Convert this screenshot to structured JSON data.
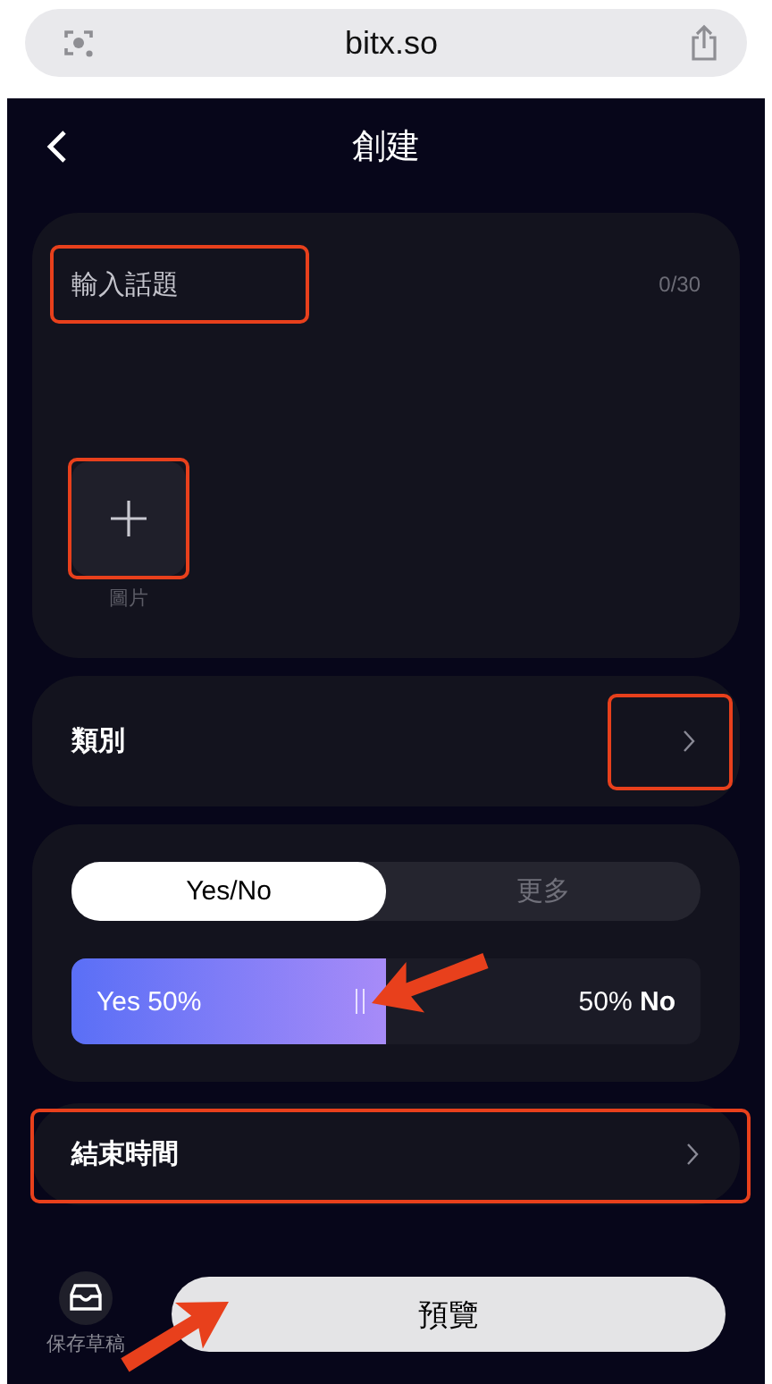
{
  "browser": {
    "url": "bitx.so"
  },
  "header": {
    "title": "創建"
  },
  "topic": {
    "placeholder": "輸入話題",
    "counter": "0/30",
    "highlighted": true
  },
  "image_upload": {
    "label": "圖片",
    "highlighted": true
  },
  "category": {
    "label": "類別",
    "highlighted": true
  },
  "market_type_tabs": [
    {
      "label": "Yes/No",
      "selected": true
    },
    {
      "label": "更多",
      "selected": false
    }
  ],
  "vote_bar": {
    "yes_label": "Yes 50%",
    "no_label": "50% **No**",
    "level": 0.5,
    "pointer": true
  },
  "end_time": {
    "label": "結束時間",
    "highlighted": true
  },
  "bottom_bar": {
    "save_draft": "保存草稿",
    "preview": "預覽",
    "pointer": true
  }
}
